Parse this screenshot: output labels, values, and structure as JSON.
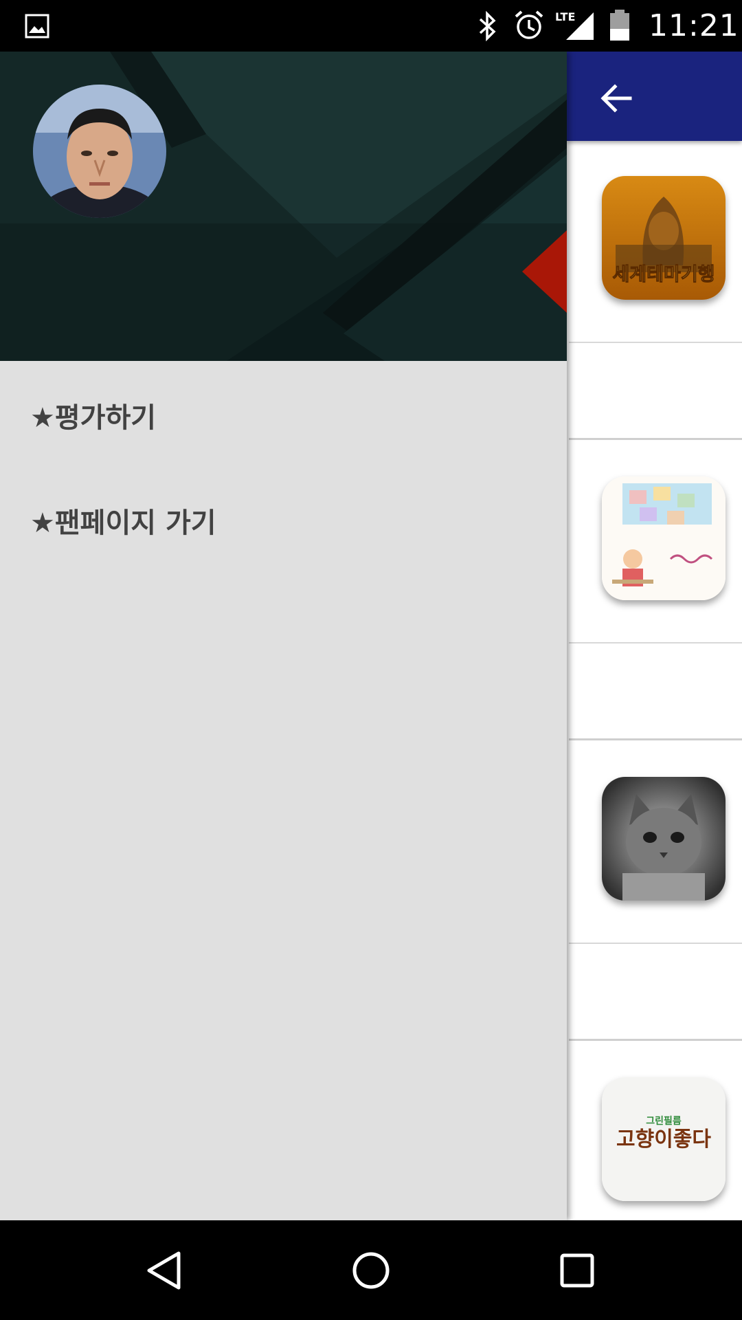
{
  "status_bar": {
    "time": "11:21",
    "network": "LTE",
    "icons": [
      "gallery-icon",
      "bluetooth-icon",
      "alarm-icon",
      "lte-signal-icon",
      "battery-icon"
    ]
  },
  "app_bar": {
    "color": "#1a237e",
    "back_icon": "arrow-back-icon"
  },
  "drawer": {
    "header_colors": {
      "dark": "#0d1a1a",
      "teal": "#1b3433",
      "accent": "#ff1a00"
    },
    "menu_items": [
      {
        "label": "★평가하기"
      },
      {
        "label": "★팬페이지 가기"
      }
    ]
  },
  "list": {
    "items": [
      {
        "icon": "travel-sphinx-thumbnail",
        "thumb_text": "세계테마기행"
      },
      {
        "icon": "puzzle-illustration-thumbnail"
      },
      {
        "icon": "kitten-photo-thumbnail"
      },
      {
        "icon": "hometown-logo-thumbnail",
        "thumb_caption": "그린필름",
        "thumb_text": "고향이좋다"
      }
    ]
  },
  "nav_bar": {
    "buttons": [
      "back-triangle-icon",
      "home-circle-icon",
      "recents-square-icon"
    ]
  }
}
